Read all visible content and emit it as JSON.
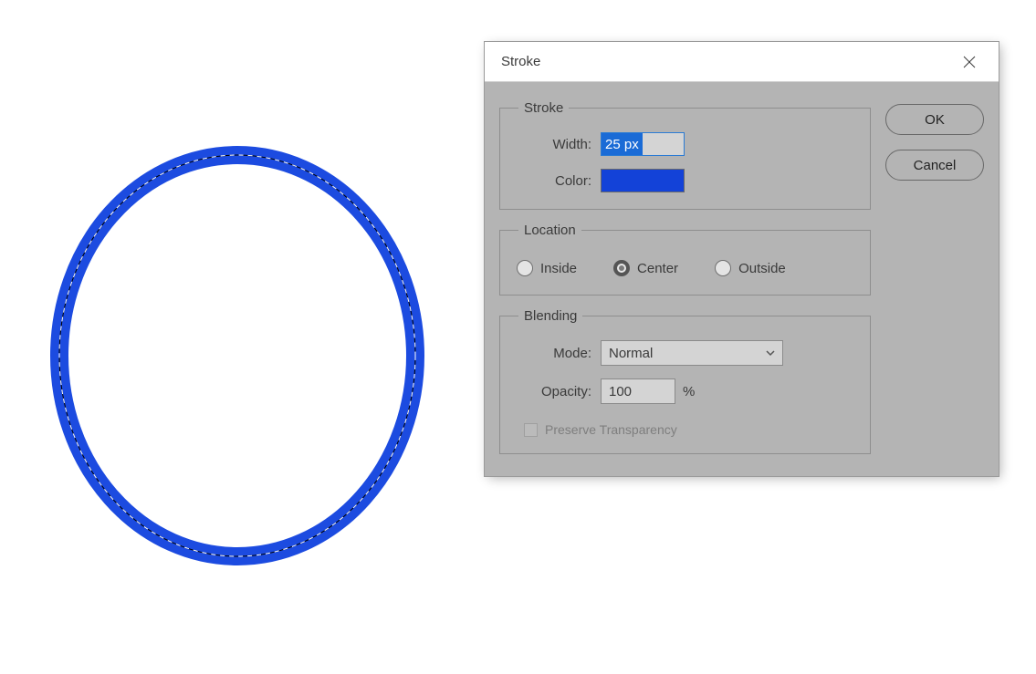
{
  "canvas": {
    "shape": "ellipse",
    "stroke_color": "#1342d8",
    "stroke_width_px": 25
  },
  "dialog": {
    "title": "Stroke",
    "buttons": {
      "ok": "OK",
      "cancel": "Cancel"
    },
    "stroke_group": {
      "legend": "Stroke",
      "width_label": "Width:",
      "width_value": "25 px",
      "color_label": "Color:",
      "color_value": "#1342d8"
    },
    "location_group": {
      "legend": "Location",
      "options": {
        "inside": "Inside",
        "center": "Center",
        "outside": "Outside"
      },
      "selected": "center"
    },
    "blending_group": {
      "legend": "Blending",
      "mode_label": "Mode:",
      "mode_value": "Normal",
      "opacity_label": "Opacity:",
      "opacity_value": "100",
      "opacity_suffix": "%",
      "preserve_label": "Preserve Transparency",
      "preserve_checked": false,
      "preserve_enabled": false
    }
  }
}
